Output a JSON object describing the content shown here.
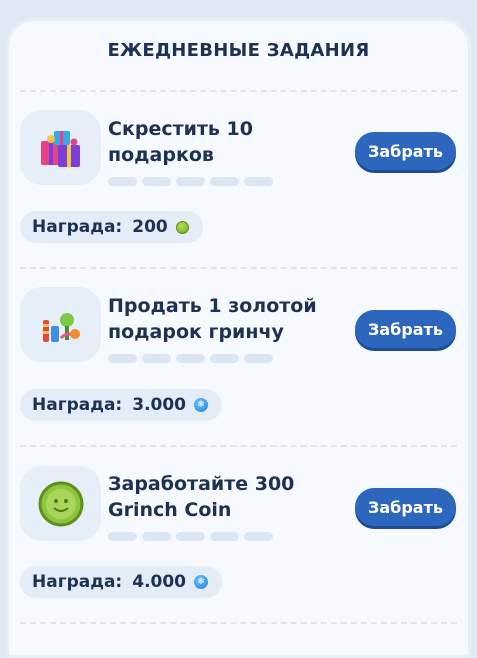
{
  "header": {
    "title": "ЕЖЕДНЕВНЫЕ ЗАДАНИЯ"
  },
  "tasks": [
    {
      "title_line1": "Скрестить 10",
      "title_line2": "подарков",
      "button_label": "Забрать",
      "reward_label": "Награда:",
      "reward_value": "200",
      "reward_currency_icon": "green-coin-icon",
      "icon": "gift-boxes-icon",
      "progress_segments": 5,
      "progress_filled": 0
    },
    {
      "title_line1": "Продать 1 золотой",
      "title_line2": "подарок гринчу",
      "button_label": "Забрать",
      "reward_label": "Награда:",
      "reward_value": "3.000",
      "reward_currency_icon": "snowflake-coin-icon",
      "icon": "candy-gifts-icon",
      "progress_segments": 5,
      "progress_filled": 0
    },
    {
      "title_line1": "Заработайте 300",
      "title_line2": "Grinch Coin",
      "button_label": "Забрать",
      "reward_label": "Награда:",
      "reward_value": "4.000",
      "reward_currency_icon": "snowflake-coin-icon",
      "icon": "grinch-coin-icon",
      "progress_segments": 5,
      "progress_filled": 0
    }
  ],
  "colors": {
    "button": "#2d66bd",
    "title_text": "#1d3153",
    "panel": "#f6f9fd",
    "progress_empty": "#dce6f2"
  }
}
